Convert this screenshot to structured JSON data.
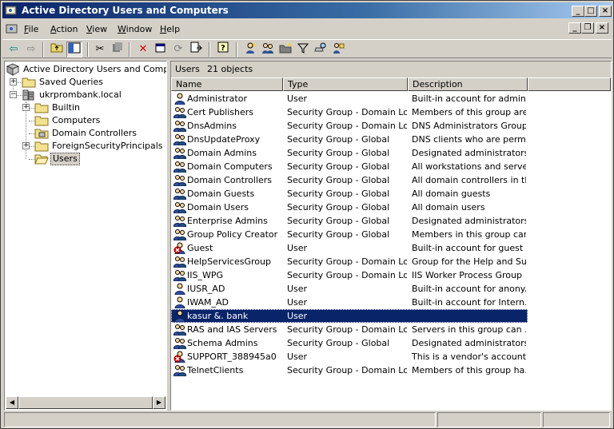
{
  "window": {
    "title": "Active Directory Users and Computers",
    "minimize": "_",
    "maximize": "□",
    "close": "×"
  },
  "mdi": {
    "minimize": "_",
    "restore": "❐",
    "close": "×"
  },
  "menu": {
    "file": {
      "key": "F",
      "rest": "ile"
    },
    "action": {
      "key": "A",
      "rest": "ction"
    },
    "view": {
      "key": "V",
      "rest": "iew"
    },
    "window": {
      "key": "W",
      "rest": "indow"
    },
    "help": {
      "key": "H",
      "rest": "elp"
    }
  },
  "toolbar": [
    "back-icon",
    "forward-icon",
    "up-folder-icon",
    "show-hide-tree-icon",
    "cut-icon",
    "copy-icon",
    "delete-icon",
    "properties-icon",
    "refresh-icon",
    "export-list-icon",
    "help-icon",
    "new-user-icon",
    "new-group-icon",
    "new-ou-icon",
    "filter-icon",
    "find-icon",
    "add-to-group-icon"
  ],
  "tree": {
    "root": "Active Directory Users and Computers",
    "saved_queries": "Saved Queries",
    "domain": "ukrprombank.local",
    "builtin": "Builtin",
    "computers": "Computers",
    "domain_controllers": "Domain Controllers",
    "fsp": "ForeignSecurityPrincipals",
    "users": "Users"
  },
  "list": {
    "header_title": "Users",
    "header_count": "21 objects",
    "columns": [
      "Name",
      "Type",
      "Description"
    ],
    "rows": [
      {
        "icon": "user",
        "name": "Administrator",
        "type": "User",
        "desc": "Built-in account for admini..."
      },
      {
        "icon": "group",
        "name": "Cert Publishers",
        "type": "Security Group - Domain Local",
        "desc": "Members of this group are..."
      },
      {
        "icon": "group",
        "name": "DnsAdmins",
        "type": "Security Group - Domain Local",
        "desc": "DNS Administrators Group"
      },
      {
        "icon": "group",
        "name": "DnsUpdateProxy",
        "type": "Security Group - Global",
        "desc": "DNS clients who are permi..."
      },
      {
        "icon": "group",
        "name": "Domain Admins",
        "type": "Security Group - Global",
        "desc": "Designated administrators..."
      },
      {
        "icon": "group",
        "name": "Domain Computers",
        "type": "Security Group - Global",
        "desc": "All workstations and serve..."
      },
      {
        "icon": "group",
        "name": "Domain Controllers",
        "type": "Security Group - Global",
        "desc": "All domain controllers in th..."
      },
      {
        "icon": "group",
        "name": "Domain Guests",
        "type": "Security Group - Global",
        "desc": "All domain guests"
      },
      {
        "icon": "group",
        "name": "Domain Users",
        "type": "Security Group - Global",
        "desc": "All domain users"
      },
      {
        "icon": "group",
        "name": "Enterprise Admins",
        "type": "Security Group - Global",
        "desc": "Designated administrators..."
      },
      {
        "icon": "group",
        "name": "Group Policy Creator ...",
        "type": "Security Group - Global",
        "desc": "Members in this group can..."
      },
      {
        "icon": "user-disabled",
        "name": "Guest",
        "type": "User",
        "desc": "Built-in account for guest ..."
      },
      {
        "icon": "group",
        "name": "HelpServicesGroup",
        "type": "Security Group - Domain Local",
        "desc": "Group for the Help and Su..."
      },
      {
        "icon": "group",
        "name": "IIS_WPG",
        "type": "Security Group - Domain Local",
        "desc": "IIS Worker Process Group"
      },
      {
        "icon": "user",
        "name": "IUSR_AD",
        "type": "User",
        "desc": "Built-in account for anony..."
      },
      {
        "icon": "user",
        "name": "IWAM_AD",
        "type": "User",
        "desc": "Built-in account for Intern..."
      },
      {
        "icon": "user",
        "name": "kasur &. bank",
        "type": "User",
        "desc": "",
        "selected": true
      },
      {
        "icon": "group",
        "name": "RAS and IAS Servers",
        "type": "Security Group - Domain Local",
        "desc": "Servers in this group can ..."
      },
      {
        "icon": "group",
        "name": "Schema Admins",
        "type": "Security Group - Global",
        "desc": "Designated administrators..."
      },
      {
        "icon": "user-disabled",
        "name": "SUPPORT_388945a0",
        "type": "User",
        "desc": "This is a vendor's account ..."
      },
      {
        "icon": "group",
        "name": "TelnetClients",
        "type": "Security Group - Domain Local",
        "desc": "Members of this group ha..."
      }
    ]
  }
}
